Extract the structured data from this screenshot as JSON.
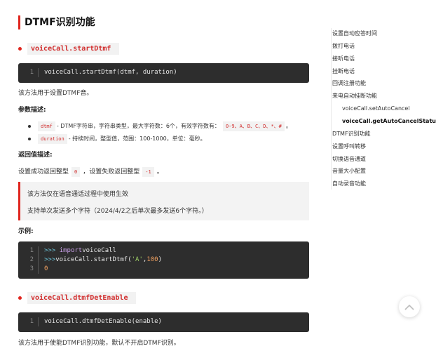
{
  "section_title": "DTMF识别功能",
  "api1": {
    "name": "voiceCall.startDtmf",
    "code_lines": [
      {
        "num": "1",
        "text": "voiceCall.startDtmf(dtmf, duration)"
      }
    ],
    "desc": "该方法用于设置DTMF音。",
    "params_label": "参数描述:",
    "param1": {
      "name": "dtmf",
      "text_a": "- DTMF字符串，字符串类型，最大字符数：6个，有效字符数有：",
      "code": "0-9、A、B、C、D、*、#",
      "text_b": "。"
    },
    "param2": {
      "name": "duration",
      "text": "- 持续时间，整型值，范围：100-1000，单位：毫秒。"
    },
    "return_label": "返回值描述:",
    "return_a": "设置成功返回整型",
    "return_code1": "0",
    "return_b": "，设置失败返回整型",
    "return_code2": "-1",
    "return_c": "。",
    "note_line1": "该方法仅在语音通话过程中使用生效",
    "note_line2": "支持单次发送多个字符（2024/4/2之后单次最多发送6个字符。）",
    "example_label": "示例:",
    "example_lines": [
      {
        "num": "1",
        "prompt": ">>>",
        "kw": "import",
        "rest": " voiceCall"
      },
      {
        "num": "2",
        "prompt": ">>>",
        "pre": " voiceCall.startDtmf(",
        "str": "'A'",
        "mid": ",",
        "n": "100",
        "post": ")"
      },
      {
        "num": "3",
        "out": "0"
      }
    ]
  },
  "api2": {
    "name": "voiceCall.dtmfDetEnable",
    "code_lines": [
      {
        "num": "1",
        "text": "voiceCall.dtmfDetEnable(enable)"
      }
    ],
    "desc": "该方法用于使能DTMF识别功能，默认不开启DTMF识别。"
  },
  "toc": [
    {
      "label": "设置自动应答时间",
      "level": 1,
      "active": false
    },
    {
      "label": "拨打电话",
      "level": 1,
      "active": false
    },
    {
      "label": "接听电话",
      "level": 1,
      "active": false
    },
    {
      "label": "挂断电话",
      "level": 1,
      "active": false
    },
    {
      "label": "回调注册功能",
      "level": 1,
      "active": false
    },
    {
      "label": "来电自动挂断功能",
      "level": 1,
      "active": false
    },
    {
      "label": "voiceCall.setAutoCancel",
      "level": 2,
      "active": false
    },
    {
      "label": "voiceCall.getAutoCancelStatus",
      "level": 2,
      "active": true
    },
    {
      "label": "DTMF识别功能",
      "level": 1,
      "active": false
    },
    {
      "label": "设置呼叫转移",
      "level": 1,
      "active": false
    },
    {
      "label": "切换语音通道",
      "level": 1,
      "active": false
    },
    {
      "label": "音量大小配置",
      "level": 1,
      "active": false
    },
    {
      "label": "自动录音功能",
      "level": 1,
      "active": false
    }
  ],
  "colors": {
    "accent": "#e0261f",
    "code_bg": "#2d2d2d",
    "inline_code": "#d12c2c"
  },
  "icons": {
    "back_to_top": "chevron-up-icon"
  }
}
